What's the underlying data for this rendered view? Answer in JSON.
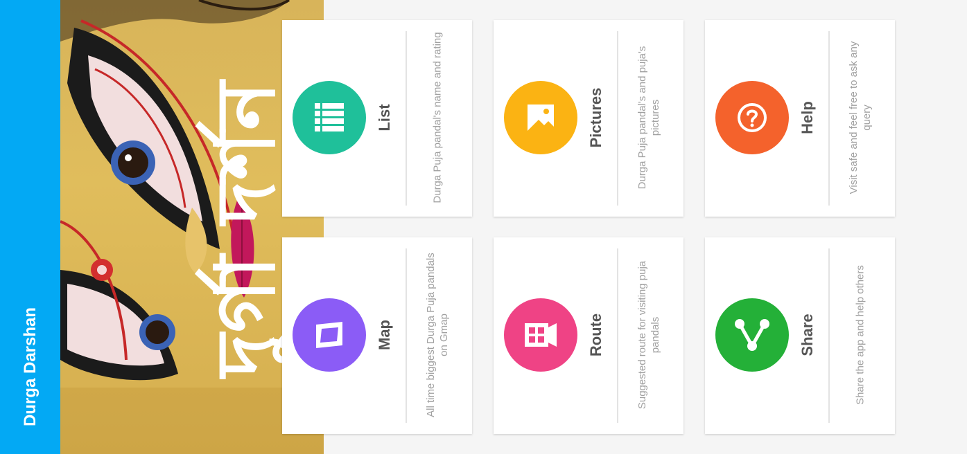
{
  "app": {
    "title": "Durga Darshan"
  },
  "hero": {
    "title": "দুর্গা দর্শন"
  },
  "colors": {
    "appbar": "#03a9f4",
    "list": "#1fc09a",
    "pictures": "#fbb313",
    "help": "#f4622c",
    "map": "#8b5cf6",
    "route": "#ef4385",
    "share": "#24b038"
  },
  "cards": [
    {
      "title": "List",
      "description": "Durga Puja pandal's name and rating",
      "icon": "list-icon"
    },
    {
      "title": "Pictures",
      "description": "Durga Puja pandal's and puja's pictures",
      "icon": "picture-icon"
    },
    {
      "title": "Help",
      "description": "Visit safe and feel free to ask any query",
      "icon": "help-icon"
    },
    {
      "title": "Map",
      "description": "All time biggest Durga Puja pandals on Gmap",
      "icon": "map-icon"
    },
    {
      "title": "Route",
      "description": "Suggested route for visiting puja pandals",
      "icon": "route-icon"
    },
    {
      "title": "Share",
      "description": "Share the app and help others",
      "icon": "share-icon"
    }
  ]
}
